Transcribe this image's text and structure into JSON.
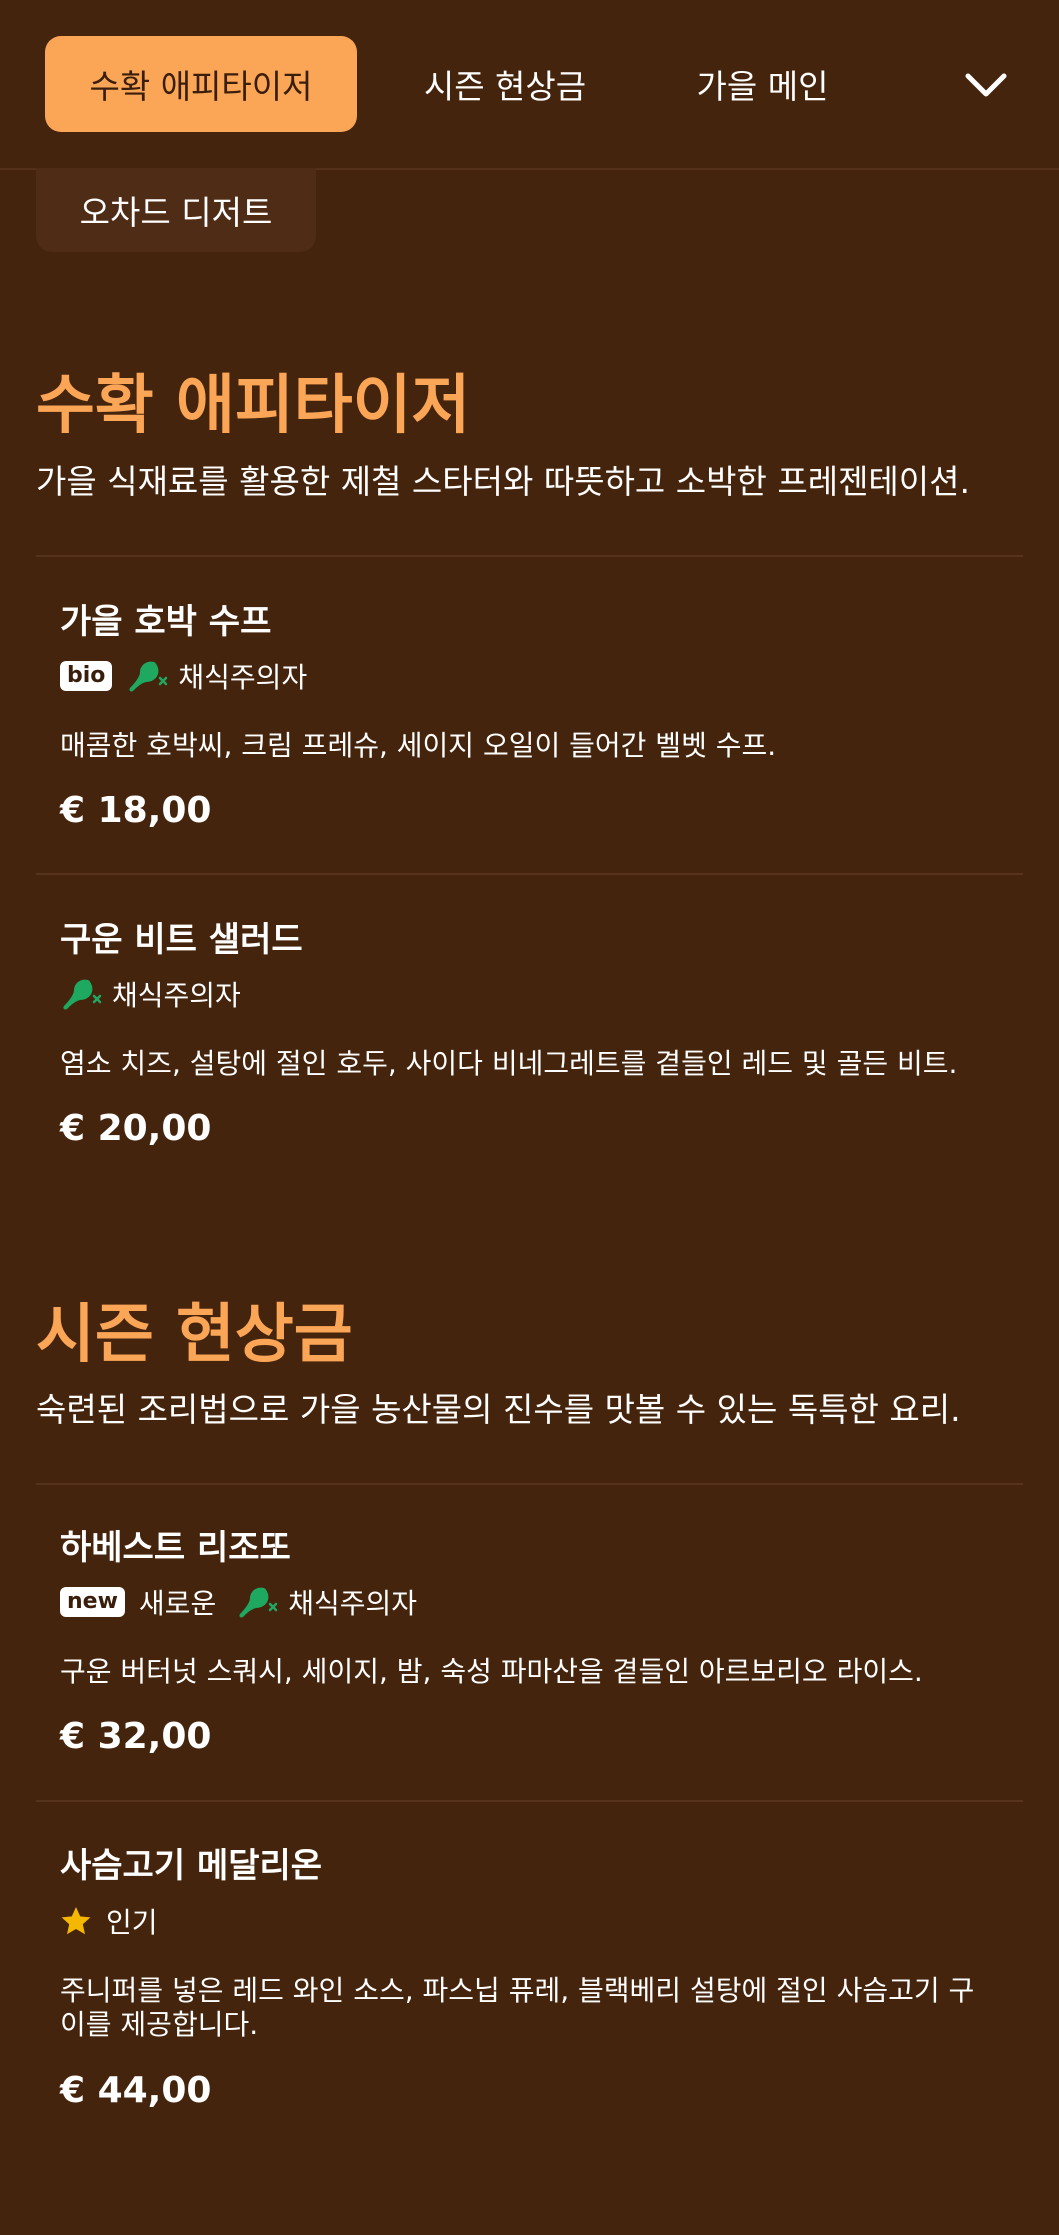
{
  "nav": {
    "tabs": [
      {
        "label": "수확 애피타이저",
        "active": true
      },
      {
        "label": "시즌 현상금",
        "active": false
      },
      {
        "label": "가을 메인",
        "active": false
      }
    ],
    "overflow_tab": {
      "label": "오차드 디저트"
    },
    "more_icon": "chevron-down-icon"
  },
  "colors": {
    "background": "#45240D",
    "accent": "#FBA556",
    "vegetarian_icon": "#1FA860",
    "star": "#F5B800"
  },
  "sections": [
    {
      "title": "수확 애피타이저",
      "description": "가을 식재료를 활용한 제철 스타터와 따뜻하고 소박한 프레젠테이션.",
      "items": [
        {
          "name": "가을 호박 수프",
          "badges": [
            "bio"
          ],
          "tags": [
            "채식주의자"
          ],
          "description": "매콤한 호박씨, 크림 프레슈, 세이지 오일이 들어간 벨벳 수프.",
          "price": "€ 18,00"
        },
        {
          "name": "구운 비트 샐러드",
          "badges": [],
          "tags": [
            "채식주의자"
          ],
          "description": "염소 치즈, 설탕에 절인 호두, 사이다 비네그레트를 곁들인 레드 및 골든 비트.",
          "price": "€ 20,00"
        }
      ]
    },
    {
      "title": "시즌 현상금",
      "description": "숙련된 조리법으로 가을 농산물의 진수를 맛볼 수 있는 독특한 요리.",
      "items": [
        {
          "name": "하베스트 리조또",
          "badges": [
            "new"
          ],
          "badge_label": "새로운",
          "tags": [
            "채식주의자"
          ],
          "description": "구운 버터넛 스쿼시, 세이지, 밤, 숙성 파마산을 곁들인 아르보리오 라이스.",
          "price": "€ 32,00"
        },
        {
          "name": "사슴고기 메달리온",
          "badges": [],
          "tags": [
            "인기"
          ],
          "tag_icon": "star-icon",
          "description": "주니퍼를 넣은 레드 와인 소스, 파스닙 퓨레, 블랙베리 설탕에 절인 사슴고기 구이를 제공합니다.",
          "price": "€ 44,00"
        }
      ]
    }
  ]
}
